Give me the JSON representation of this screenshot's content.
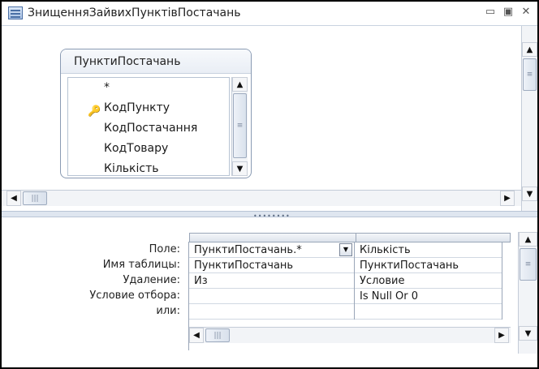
{
  "window": {
    "title": "ЗнищенняЗайвихПунктівПостачань",
    "buttons": [
      "▭",
      "▣",
      "✕"
    ]
  },
  "table_box": {
    "title": "ПунктиПостачань",
    "fields": [
      "*",
      "КодПункту",
      "КодПостачання",
      "КодТовару",
      "Кількість"
    ],
    "primary_key_field": "КодПункту"
  },
  "grid": {
    "row_labels": [
      "Поле:",
      "Имя таблицы:",
      "Удаление:",
      "Условие отбора:",
      "или:"
    ],
    "columns": [
      {
        "field": "ПунктиПостачань.*",
        "table": "ПунктиПостачань",
        "delete": "Из",
        "criteria": "",
        "or": ""
      },
      {
        "field": "Кількість",
        "table": "ПунктиПостачань",
        "delete": "Условие",
        "criteria": "Is Null Or 0",
        "or": ""
      }
    ]
  },
  "icons": {
    "key": "🔑",
    "up": "▲",
    "down": "▼",
    "left": "◀",
    "right": "▶",
    "dropdown": "▼",
    "thumb_grip": "≡",
    "hthumb_grip": "|||",
    "splitter_grip": "••••••••"
  }
}
